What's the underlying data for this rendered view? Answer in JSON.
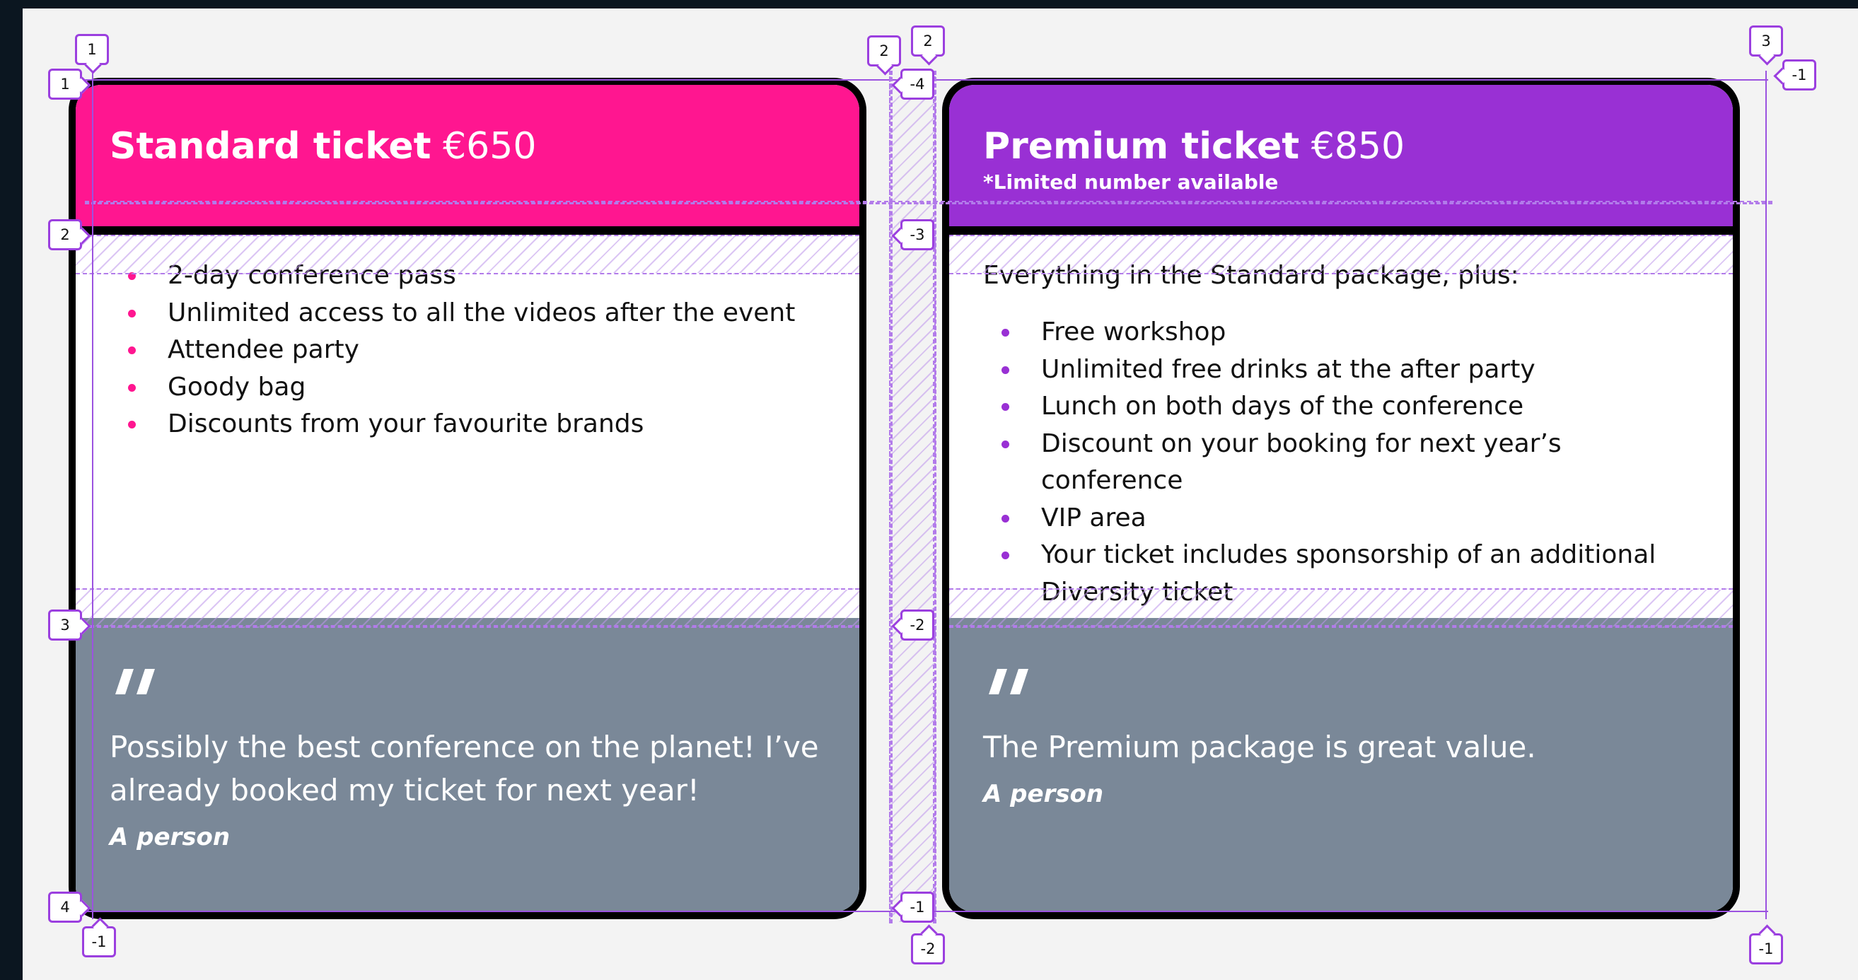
{
  "colors": {
    "standard_accent": "#ff1690",
    "premium_accent": "#9930d4",
    "card_border": "#000000",
    "quote_panel": "#7a8898",
    "grid_overlay": "#9b3fdf",
    "page_background": "#f3f3f3",
    "window_background": "#0b1620"
  },
  "cards": [
    {
      "name": "Standard ticket",
      "price": "€650",
      "note": "",
      "intro": "",
      "features": [
        "2-day conference pass",
        "Unlimited access to all the videos after the event",
        "Attendee party",
        "Goody bag",
        "Discounts from your favourite brands"
      ],
      "quote_icon": "quote-icon",
      "quote": "Possibly the best conference on the planet! I’ve already booked my ticket for next year!",
      "author": "A person"
    },
    {
      "name": "Premium ticket",
      "price": "€850",
      "note": "*Limited number available",
      "intro": "Everything in the Standard package, plus:",
      "features": [
        "Free workshop",
        "Unlimited free drinks at the after party",
        "Lunch on both days of the conference",
        "Discount on your booking for next year’s conference",
        "VIP area",
        "Your ticket includes sponsorship of an additional Diversity ticket"
      ],
      "quote_icon": "quote-icon",
      "quote": "The Premium package is great value.",
      "author": "A person"
    }
  ],
  "grid_inspector": {
    "row_labels_left": [
      "1",
      "2",
      "3",
      "4"
    ],
    "row_labels_middle": [
      "-4",
      "-3",
      "-2",
      "-1"
    ],
    "column_labels_top": [
      "1",
      "2",
      "2",
      "3"
    ],
    "negative_labels": [
      "-1",
      "-1",
      "-2",
      "-1"
    ]
  }
}
